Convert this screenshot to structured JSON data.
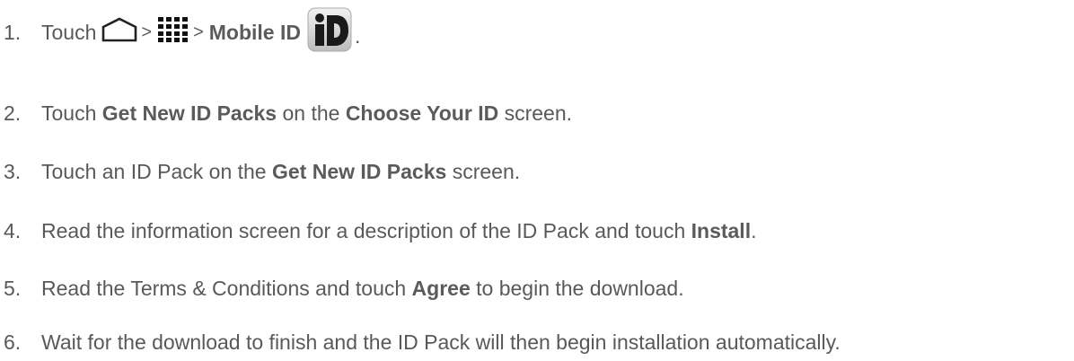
{
  "steps": [
    {
      "number": "1.",
      "text_touch": "Touch",
      "separator1": ">",
      "separator2": ">",
      "app_name": "Mobile ID",
      "end": ".",
      "icons": [
        "home-icon",
        "apps-grid-icon",
        "mobile-id-app-icon"
      ]
    },
    {
      "number": "2.",
      "t1": "Touch ",
      "b1": "Get New ID Packs",
      "t2": " on the ",
      "b2": "Choose Your ID",
      "t3": " screen."
    },
    {
      "number": "3.",
      "t1": "Touch an ID Pack on the ",
      "b1": "Get New ID Packs",
      "t2": " screen."
    },
    {
      "number": "4.",
      "t1": "Read the information screen for a description of the ID Pack and touch ",
      "b1": "Install",
      "t2": "."
    },
    {
      "number": "5.",
      "t1": "Read the Terms & Conditions and touch ",
      "b1": "Agree",
      "t2": " to begin the download."
    },
    {
      "number": "6.",
      "t1": "Wait for the download to finish and the ID Pack will then begin installation automatically."
    }
  ]
}
